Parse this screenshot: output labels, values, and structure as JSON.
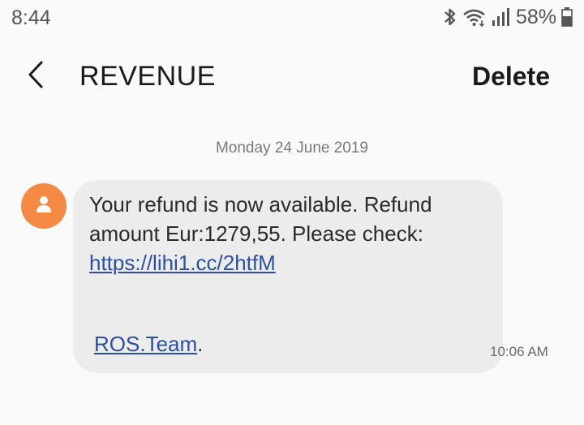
{
  "status_bar": {
    "time": "8:44",
    "battery_percent": "58%",
    "icons": [
      "bluetooth-icon",
      "wifi-icon",
      "signal-icon",
      "battery-icon"
    ]
  },
  "app_bar": {
    "back_icon": "chevron-left-icon",
    "title": "REVENUE",
    "delete_label": "Delete"
  },
  "conversation": {
    "date_separator": "Monday 24 June 2019",
    "message": {
      "line1": "Your refund is now available. Refund",
      "line2": "amount Eur:1279,55. Please check:",
      "link": "https://lihi1.cc/2htfM",
      "signature_link": "ROS.Team",
      "signature_suffix": ".",
      "time": "10:06 AM"
    },
    "avatar_color": "#f58a46"
  }
}
